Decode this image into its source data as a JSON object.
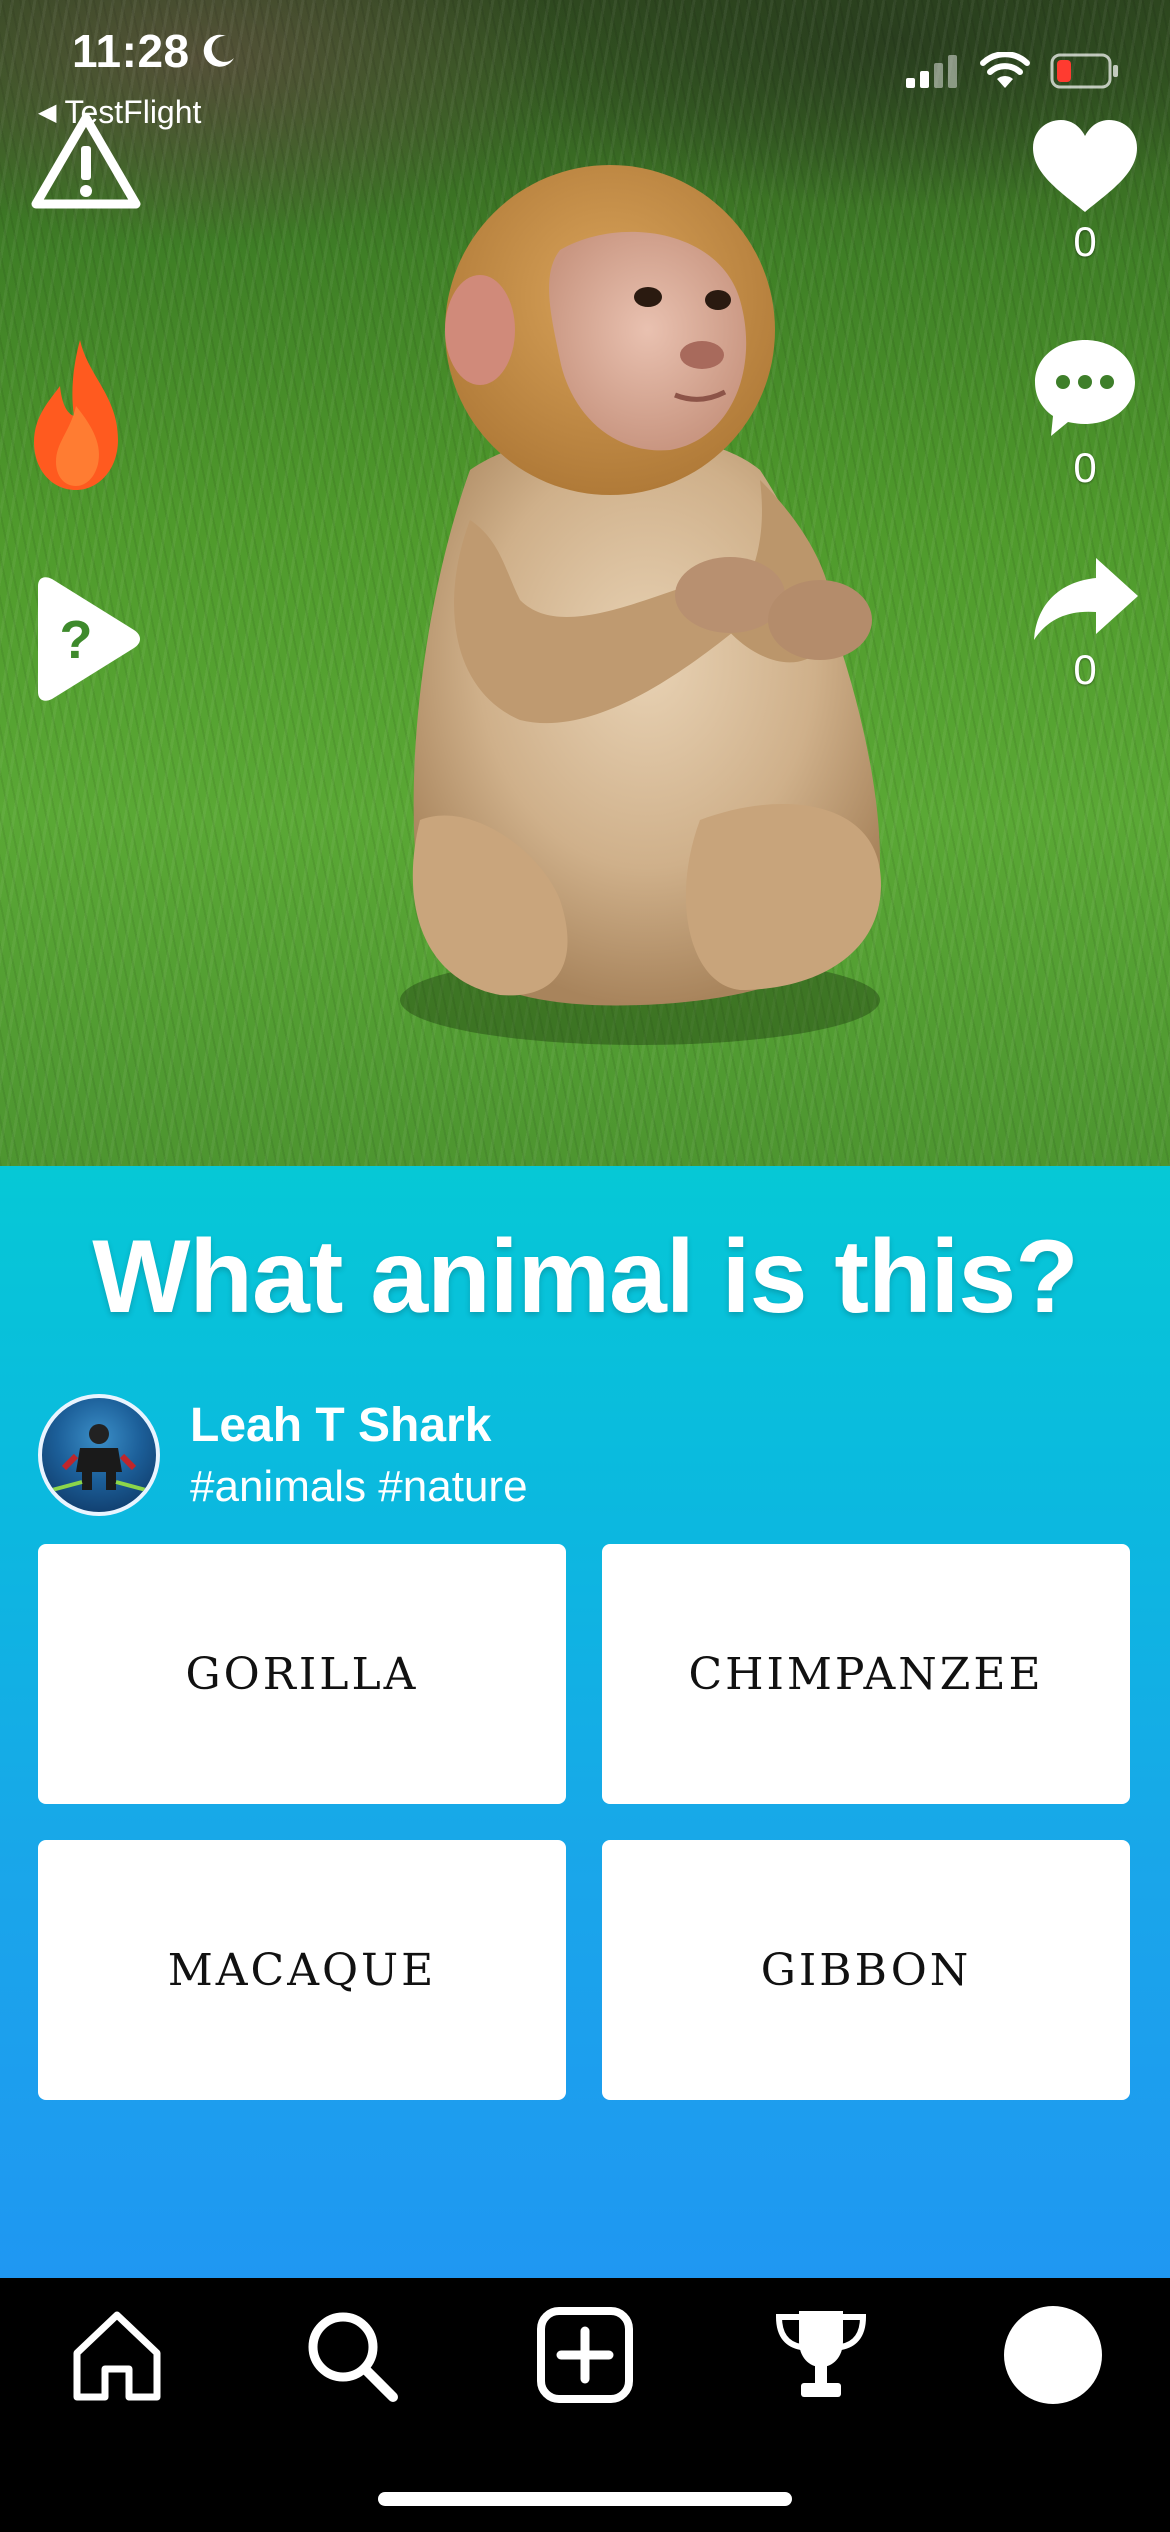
{
  "status_bar": {
    "time": "11:28",
    "back_label": "TestFlight",
    "icons": [
      "moon-icon",
      "cellular-signal-icon",
      "wifi-icon",
      "battery-low-icon"
    ],
    "battery_color": "#ff3b30"
  },
  "overlay_left": {
    "icons": [
      "warning-icon",
      "flame-icon",
      "help-play-icon"
    ],
    "flame_color": "#ff5a1f"
  },
  "actions": {
    "like_count": "0",
    "comment_count": "0",
    "share_count": "0"
  },
  "quiz": {
    "question": "What animal is this?",
    "author_name": "Leah T Shark",
    "hashtags": "#animals #nature",
    "answers": [
      "GORILLA",
      "CHIMPANZEE",
      "MACAQUE",
      "GIBBON"
    ]
  },
  "tabbar": {
    "items": [
      "home-icon",
      "search-icon",
      "create-post-icon",
      "trophy-icon",
      "profile-avatar"
    ]
  },
  "colors": {
    "panel_top": "#06c8d6",
    "panel_bottom": "#1f97f2",
    "tabbar_bg": "#000000"
  }
}
